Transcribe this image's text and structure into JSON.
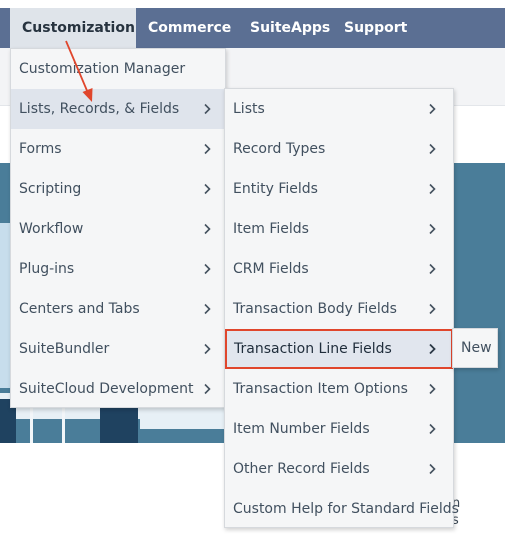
{
  "nav": {
    "items": [
      {
        "label": "Customization"
      },
      {
        "label": "Commerce"
      },
      {
        "label": "SuiteApps"
      },
      {
        "label": "Support"
      }
    ]
  },
  "customization_menu": {
    "items": [
      {
        "label": "Customization Manager"
      },
      {
        "label": "Lists, Records, & Fields"
      },
      {
        "label": "Forms"
      },
      {
        "label": "Scripting"
      },
      {
        "label": "Workflow"
      },
      {
        "label": "Plug-ins"
      },
      {
        "label": "Centers and Tabs"
      },
      {
        "label": "SuiteBundler"
      },
      {
        "label": "SuiteCloud Development"
      }
    ]
  },
  "lists_submenu": {
    "items": [
      {
        "label": "Lists"
      },
      {
        "label": "Record Types"
      },
      {
        "label": "Entity Fields"
      },
      {
        "label": "Item Fields"
      },
      {
        "label": "CRM Fields"
      },
      {
        "label": "Transaction Body Fields"
      },
      {
        "label": "Transaction Line Fields"
      },
      {
        "label": "Transaction Item Options"
      },
      {
        "label": "Item Number Fields"
      },
      {
        "label": "Other Record Fields"
      },
      {
        "label": "Custom Help for Standard Fields"
      }
    ]
  },
  "transaction_line_submenu": {
    "items": [
      {
        "label": "New"
      }
    ]
  },
  "colors": {
    "nav_bar": "#5b6f93",
    "nav_active": "#dfe4ea",
    "menu_bg": "#f5f6f7",
    "hover_bg": "#dfe4ec",
    "highlight_border": "#e0462c",
    "annotation_arrow": "#e0462c"
  }
}
